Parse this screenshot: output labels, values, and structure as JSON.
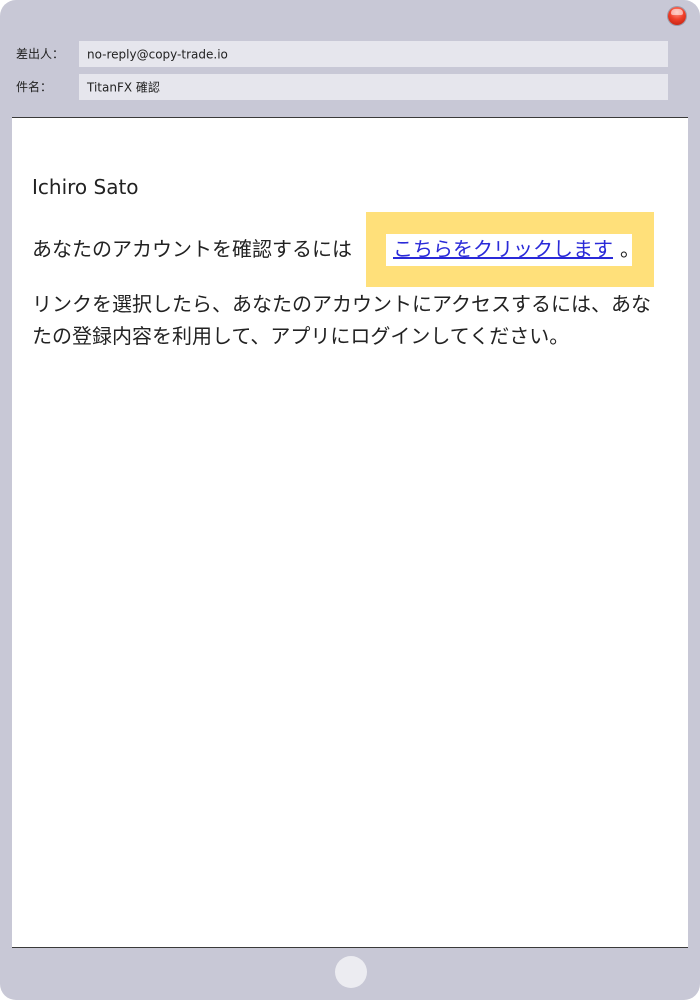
{
  "header": {
    "from_label": "差出人：",
    "from_value": "no-reply@copy-trade.io",
    "subject_label": "件名：",
    "subject_value": "TitanFX 確認"
  },
  "body": {
    "greeting": "Ichiro Sato",
    "line1_prefix": "あなたのアカウントを確認するには",
    "link_text": "こちらをクリックします",
    "link_suffix": "。",
    "paragraph2": "リンクを選択したら、あなたのアカウントにアクセスするには、あなたの登録内容を利用して、アプリにログインしてください。"
  },
  "colors": {
    "frame": "#c8c8d6",
    "highlight": "#ffe07a",
    "link": "#2a2ad8"
  },
  "icons": {
    "close": "close-icon",
    "home": "home-button-icon"
  }
}
